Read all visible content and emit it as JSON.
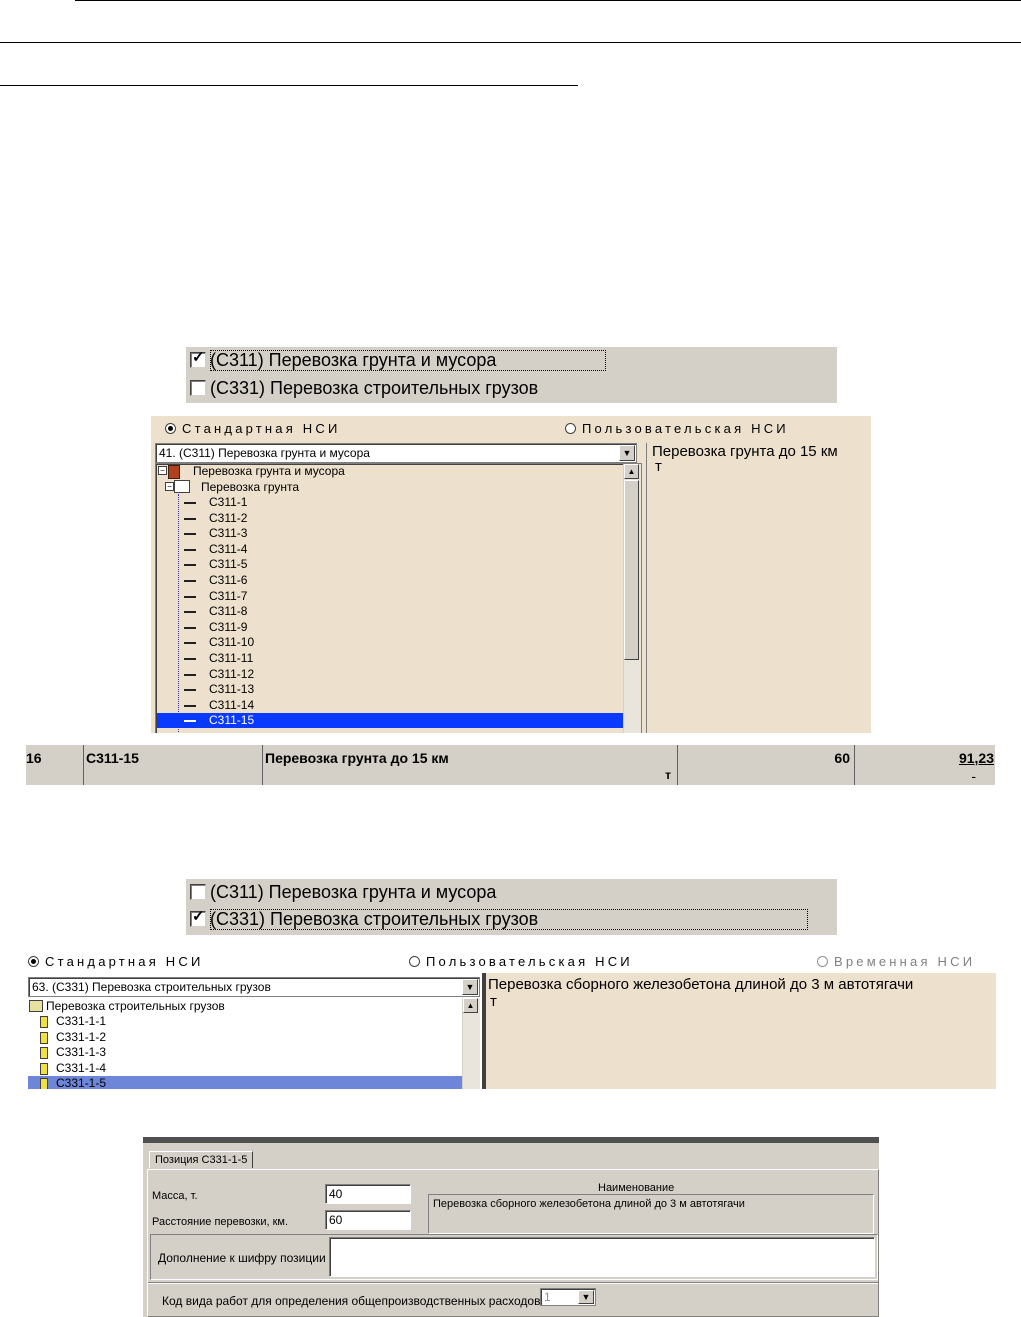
{
  "section1": {
    "checkboxes": [
      {
        "label": "(С311) Перевозка грунта и мусора",
        "checked": true
      },
      {
        "label": "(С331) Перевозка строительных грузов",
        "checked": false
      }
    ],
    "nsi": {
      "radio_standard": "Стандартная НСИ",
      "radio_user": "Пользовательская НСИ",
      "combo_value": "41. (С311) Перевозка грунта и мусора",
      "tree_root": "Перевозка грунта и мусора",
      "tree_group": "Перевозка грунта",
      "tree_items": [
        "С311-1",
        "С311-2",
        "С311-3",
        "С311-4",
        "С311-5",
        "С311-6",
        "С311-7",
        "С311-8",
        "С311-9",
        "С311-10",
        "С311-11",
        "С311-12",
        "С311-13",
        "С311-14",
        "С311-15"
      ],
      "selected_item": "С311-15",
      "description": "Перевозка грунта до 15 км",
      "unit": "т"
    }
  },
  "estimate_row": {
    "num": "16",
    "code": "С311-15",
    "name": "Перевозка грунта до 15 км",
    "unit": "т",
    "qty": "60",
    "price": "91,23",
    "price_sub": "-"
  },
  "section2": {
    "checkboxes": [
      {
        "label": "(С311) Перевозка грунта и мусора",
        "checked": false
      },
      {
        "label": "(С331) Перевозка строительных грузов",
        "checked": true
      }
    ],
    "nsi": {
      "radio_standard": "Стандартная НСИ",
      "radio_user": "Пользовательская НСИ",
      "radio_temp": "Временная НСИ",
      "combo_value": "63. (С331) Перевозка строительных грузов",
      "tree_root": "Перевозка строительных грузов",
      "tree_items": [
        "С331-1-1",
        "С331-1-2",
        "С331-1-3",
        "С331-1-4",
        "С331-1-5"
      ],
      "description": "Перевозка сборного железобетона длиной до 3 м автотягачи",
      "unit": "т"
    }
  },
  "dialog": {
    "tab": "Позиция С331-1-5",
    "mass_label": "Масса, т.",
    "mass_value": "40",
    "distance_label": "Расстояние перевозки, км.",
    "distance_value": "60",
    "name_header": "Наименование",
    "name_value": "Перевозка сборного железобетона длиной до 3 м автотягачи",
    "supplement_label": "Дополнение к шифру позиции",
    "supplement_value": "",
    "code_label": "Код вида работ для определения общепроизводственных расходов",
    "code_value": "1"
  }
}
